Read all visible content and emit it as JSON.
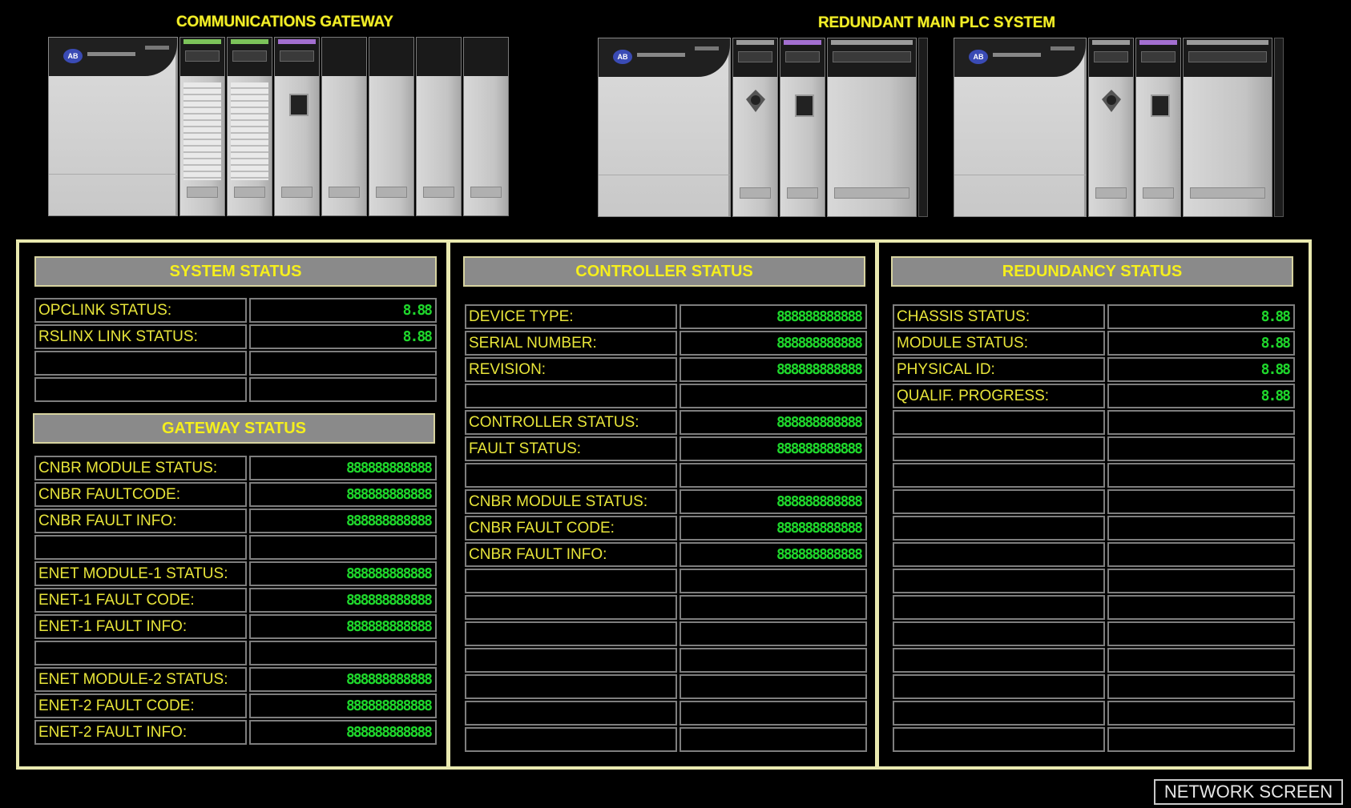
{
  "hardware": {
    "gateway_title": "COMMUNICATIONS GATEWAY",
    "redundant_title": "REDUNDANT MAIN PLC SYSTEM"
  },
  "system_status": {
    "title": "SYSTEM STATUS",
    "rows": [
      {
        "label": "OPCLINK STATUS:",
        "value": "8.88"
      },
      {
        "label": "RSLINX LINK STATUS:",
        "value": "8.88"
      },
      {
        "label": "",
        "value": ""
      },
      {
        "label": "",
        "value": ""
      }
    ]
  },
  "gateway_status": {
    "title": "GATEWAY STATUS",
    "rows": [
      {
        "label": "CNBR MODULE STATUS:",
        "value": "888888888888"
      },
      {
        "label": "CNBR FAULTCODE:",
        "value": "888888888888"
      },
      {
        "label": "CNBR FAULT INFO:",
        "value": "888888888888"
      },
      {
        "label": "",
        "value": ""
      },
      {
        "label": "ENET MODULE-1 STATUS:",
        "value": "888888888888"
      },
      {
        "label": "ENET-1 FAULT CODE:",
        "value": "888888888888"
      },
      {
        "label": "ENET-1 FAULT INFO:",
        "value": "888888888888"
      },
      {
        "label": "",
        "value": ""
      },
      {
        "label": "ENET MODULE-2 STATUS:",
        "value": "888888888888"
      },
      {
        "label": "ENET-2 FAULT CODE:",
        "value": "888888888888"
      },
      {
        "label": "ENET-2 FAULT INFO:",
        "value": "888888888888"
      }
    ]
  },
  "controller_status": {
    "title": "CONTROLLER STATUS",
    "rows": [
      {
        "label": "DEVICE TYPE:",
        "value": "888888888888"
      },
      {
        "label": "SERIAL NUMBER:",
        "value": "888888888888"
      },
      {
        "label": "REVISION:",
        "value": "888888888888"
      },
      {
        "label": "",
        "value": ""
      },
      {
        "label": "CONTROLLER STATUS:",
        "value": "888888888888"
      },
      {
        "label": "FAULT STATUS:",
        "value": "888888888888"
      },
      {
        "label": "",
        "value": ""
      },
      {
        "label": "CNBR MODULE STATUS:",
        "value": "888888888888"
      },
      {
        "label": "CNBR FAULT CODE:",
        "value": "888888888888"
      },
      {
        "label": "CNBR FAULT INFO:",
        "value": "888888888888"
      },
      {
        "label": "",
        "value": ""
      },
      {
        "label": "",
        "value": ""
      },
      {
        "label": "",
        "value": ""
      },
      {
        "label": "",
        "value": ""
      },
      {
        "label": "",
        "value": ""
      },
      {
        "label": "",
        "value": ""
      },
      {
        "label": "",
        "value": ""
      }
    ]
  },
  "redundancy_status": {
    "title": "REDUNDANCY STATUS",
    "rows": [
      {
        "label": "CHASSIS STATUS:",
        "value": "8.88"
      },
      {
        "label": "MODULE STATUS:",
        "value": "8.88"
      },
      {
        "label": "PHYSICAL ID:",
        "value": "8.88"
      },
      {
        "label": "QUALIF. PROGRESS:",
        "value": "8.88"
      },
      {
        "label": "",
        "value": ""
      },
      {
        "label": "",
        "value": ""
      },
      {
        "label": "",
        "value": ""
      },
      {
        "label": "",
        "value": ""
      },
      {
        "label": "",
        "value": ""
      },
      {
        "label": "",
        "value": ""
      },
      {
        "label": "",
        "value": ""
      },
      {
        "label": "",
        "value": ""
      },
      {
        "label": "",
        "value": ""
      },
      {
        "label": "",
        "value": ""
      },
      {
        "label": "",
        "value": ""
      },
      {
        "label": "",
        "value": ""
      },
      {
        "label": "",
        "value": ""
      }
    ]
  },
  "footer": {
    "network_button": "NETWORK SCREEN"
  }
}
